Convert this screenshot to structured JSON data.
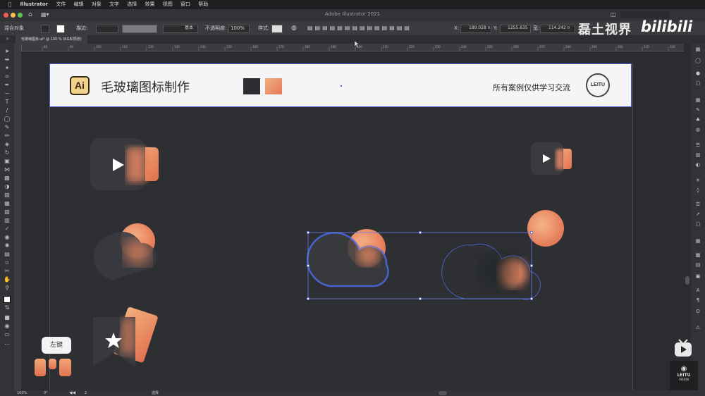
{
  "menubar": {
    "apple": "",
    "items": [
      "Illustrator",
      "文件",
      "编辑",
      "对象",
      "文字",
      "选择",
      "效果",
      "视图",
      "窗口",
      "帮助"
    ]
  },
  "titlebar": {
    "title": "Adobe Illustrator 2021"
  },
  "controlbar": {
    "selection_label": "混合对象",
    "stroke_label": "描边:",
    "stroke_style": "基本",
    "opacity_label": "不透明度:",
    "opacity_value": "100%",
    "style_label": "样式:",
    "x_label": "X:",
    "x_value": "189.028 n",
    "y_label": "Y:",
    "y_value": "1255.635",
    "w_label": "宽:",
    "w_value": "114.242 n"
  },
  "document": {
    "tab_label": "毛玻璃图标.ai* @ 100 % (RGB/预览)"
  },
  "ruler": {
    "ticks": [
      "80",
      "90",
      "100",
      "110",
      "120",
      "130",
      "140",
      "150",
      "160",
      "170",
      "180",
      "190",
      "200",
      "210",
      "220",
      "230",
      "240",
      "250",
      "260",
      "270",
      "280",
      "290",
      "300",
      "310",
      "320"
    ]
  },
  "banner": {
    "logo_text": "Ai",
    "title": "毛玻璃图标制作",
    "subtitle": "所有案例仅供学习交流",
    "badge_text": "LEITU",
    "swatch_colors": [
      "#2d2e32",
      "#e8795a"
    ]
  },
  "watermark": {
    "left_text": "磊土视界",
    "right_text": "bilibili"
  },
  "tooltip": {
    "text": "左键"
  },
  "corner": {
    "leitu_text": "LEITU",
    "leitu_sub": "VISION"
  },
  "statusbar": {
    "zoom": "100%",
    "rotation": "0°",
    "page": "2",
    "mode": "选择"
  },
  "colors": {
    "accent": "#4c5dd6",
    "orange": "#e8795a",
    "peach": "#f0b07e"
  }
}
